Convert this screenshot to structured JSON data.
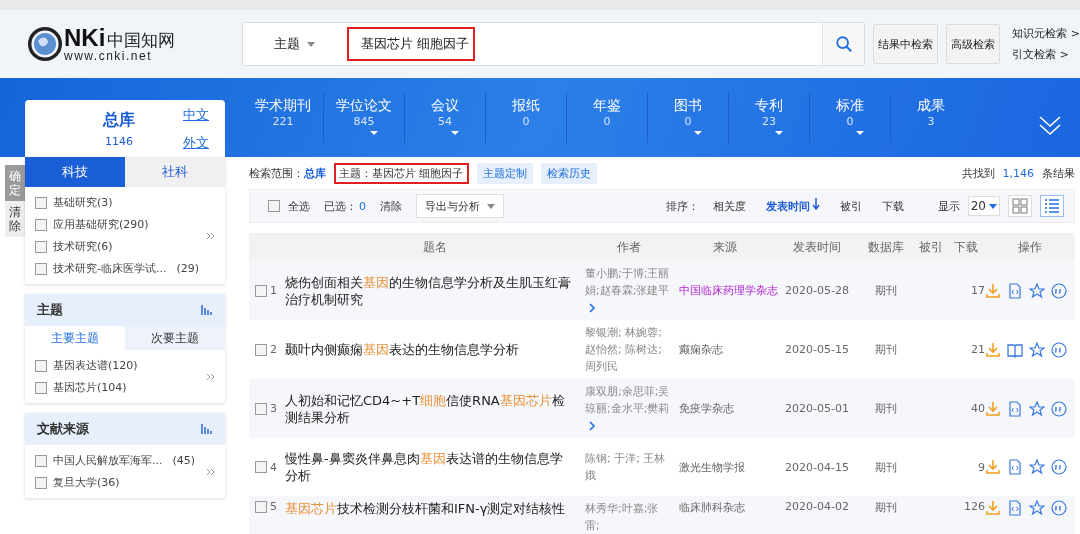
{
  "logo": {
    "mark": "NKi",
    "name": "中国知网",
    "url": "www.cnki.net"
  },
  "search": {
    "field": "主题",
    "value": "基因芯片 细胞因子",
    "annotated": true,
    "buttons": [
      "结果中检索",
      "高级检索"
    ],
    "links": [
      "知识元检索 >",
      "引文检索 >"
    ]
  },
  "library": {
    "title": "总库",
    "count": "1146",
    "links": [
      "中文",
      "外文"
    ]
  },
  "nav": [
    {
      "label": "学术期刊",
      "count": "221",
      "has_menu": false
    },
    {
      "label": "学位论文",
      "count": "845",
      "has_menu": true
    },
    {
      "label": "会议",
      "count": "54",
      "has_menu": true
    },
    {
      "label": "报纸",
      "count": "0",
      "has_menu": false
    },
    {
      "label": "年鉴",
      "count": "0",
      "has_menu": false
    },
    {
      "label": "图书",
      "count": "0",
      "has_menu": true
    },
    {
      "label": "专利",
      "count": "23",
      "has_menu": true
    },
    {
      "label": "标准",
      "count": "0",
      "has_menu": true
    },
    {
      "label": "成果",
      "count": "3",
      "has_menu": false
    }
  ],
  "side_buttons": [
    "确定",
    "清除"
  ],
  "side_tabs": [
    {
      "label": "科技",
      "selected": true
    },
    {
      "label": "社科",
      "selected": false
    }
  ],
  "side_items": [
    {
      "label": "基础研究(3)",
      "checked": false
    },
    {
      "label": "应用基础研究(290)",
      "checked": false
    },
    {
      "label": "技术研究(6)",
      "checked": false
    },
    {
      "label": "技术研究-临床医学试...",
      "count": "(29)",
      "checked": false
    }
  ],
  "groups": [
    {
      "title": "主题",
      "tabs": [
        {
          "label": "主要主题",
          "selected": true
        },
        {
          "label": "次要主题",
          "selected": false
        }
      ],
      "items": [
        {
          "label": "基因表达谱(120)",
          "checked": false
        },
        {
          "label": "基因芯片(104)",
          "checked": false
        }
      ]
    },
    {
      "title": "文献来源",
      "items": [
        {
          "label": "中国人民解放军海军...",
          "count": "(45)",
          "checked": false
        },
        {
          "label": "复旦大学(36)",
          "checked": false
        }
      ]
    }
  ],
  "scope": {
    "label": "检索范围：",
    "value": "总库",
    "query": "主题：基因芯片 细胞因子",
    "query_annotated": true,
    "tags": [
      "主题定制",
      "检索历史"
    ],
    "total_prefix": "共找到",
    "total": "1,146",
    "total_suffix": "条结果"
  },
  "toolbar": {
    "select_all": "全选",
    "select_all_checked": false,
    "selected_label": "已选：",
    "selected_count": "0",
    "clear": "清除",
    "export": "导出与分析",
    "sort_label": "排序：",
    "sorts": [
      {
        "label": "相关度",
        "selected": false
      },
      {
        "label": "发表时间",
        "selected": true
      },
      {
        "label": "被引",
        "selected": false
      },
      {
        "label": "下载",
        "selected": false
      }
    ],
    "show_label": "显示",
    "page_size": "20",
    "views": [
      {
        "kind": "grid",
        "selected": false
      },
      {
        "kind": "list",
        "selected": true
      }
    ]
  },
  "table": {
    "columns": [
      "题名",
      "作者",
      "来源",
      "发表时间",
      "数据库",
      "被引",
      "下载",
      "操作"
    ],
    "rows": [
      {
        "num": "1",
        "checked": false,
        "title": [
          {
            "text": "烧伤创面相关",
            "hit": false
          },
          {
            "text": "基因",
            "hit": true
          },
          {
            "text": "的生物信息学分析及生肌玉红膏治疗机制研究",
            "hit": false
          }
        ],
        "authors": "董小鹏;于博;王丽娟;赵春霖;张建平",
        "more": true,
        "source": "中国临床药理学杂志",
        "visited": true,
        "date": "2020-05-28",
        "db": "期刊",
        "downloads": "17",
        "kind": "html"
      },
      {
        "num": "2",
        "checked": false,
        "title": [
          {
            "text": "颞叶内侧癫痫",
            "hit": false
          },
          {
            "text": "基因",
            "hit": true
          },
          {
            "text": "表达的生物信息学分析",
            "hit": false
          }
        ],
        "authors": "黎银潮; 林婉蓉; 赵怡然; 陈树达; 周列民",
        "more": false,
        "source": "癫痫杂志",
        "visited": false,
        "date": "2020-05-15",
        "db": "期刊",
        "downloads": "21",
        "kind": "book"
      },
      {
        "num": "3",
        "checked": false,
        "title": [
          {
            "text": "人初始和记忆CD4~+T",
            "hit": false
          },
          {
            "text": "细胞",
            "hit": true
          },
          {
            "text": "信使RNA",
            "hit": false
          },
          {
            "text": "基因芯片",
            "hit": true
          },
          {
            "text": "检测结果分析",
            "hit": false
          }
        ],
        "authors": "康双朋;余思菲;吴琼丽;金水平;樊莉",
        "more": true,
        "source": "免疫学杂志",
        "visited": false,
        "date": "2020-05-01",
        "db": "期刊",
        "downloads": "40",
        "kind": "html"
      },
      {
        "num": "4",
        "checked": false,
        "title": [
          {
            "text": "慢性鼻-鼻窦炎伴鼻息肉",
            "hit": false
          },
          {
            "text": "基因",
            "hit": true
          },
          {
            "text": "表达谱的生物信息学分析",
            "hit": false
          }
        ],
        "authors": "陈钢; 于洋; 王林娥",
        "more": false,
        "source": "激光生物学报",
        "visited": false,
        "date": "2020-04-15",
        "db": "期刊",
        "downloads": "9",
        "kind": "html"
      },
      {
        "num": "5",
        "checked": false,
        "title": [
          {
            "text": "基因芯片",
            "hit": true
          },
          {
            "text": "技术检测分枝杆菌和IFN-γ测定对结核性",
            "hit": false
          }
        ],
        "authors": "林秀华;叶嘉;张雷;",
        "more": false,
        "source": "临床肺科杂志",
        "visited": false,
        "date": "2020-04-02",
        "db": "期刊",
        "downloads": "126",
        "kind": "html"
      }
    ]
  }
}
